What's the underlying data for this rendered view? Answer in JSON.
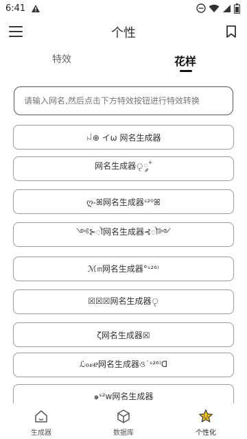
{
  "status_bar": {
    "time": "6:41",
    "icons": [
      "warning-icon",
      "do-not-disturb-icon",
      "wifi-icon",
      "signal-icon",
      "battery-icon"
    ]
  },
  "app_bar": {
    "title": "个性",
    "menu_icon": "hamburger-menu-icon",
    "bookmark_icon": "bookmark-icon"
  },
  "tabs": [
    {
      "label": "特效",
      "selected": false
    },
    {
      "label": "花样",
      "selected": true
    }
  ],
  "input": {
    "placeholder": "请输入网名,然后点击下方特效按钮进行特效转换",
    "value": ""
  },
  "results": [
    "ꈤ⊕ イω 网名生成器",
    "网名生成器ৃ༘˚",
    "ღ֊ꕤ网名生成器ˢ²⁰ꕤ",
    "༺⊱ꠧ网名生成器⊰ꠧ༻",
    "ℳ௱网名生成器°ˢ²⁶⁾",
    "☒☒☒网名生成器ৃ",
    "ζ网名生成器☒",
    "ℒℴ𝓋ℯ网名生成器ও˙ˢ²⁶⁾ᗡ",
    "๑ˢ²w网名生成器"
  ],
  "bottom_nav": [
    {
      "label": "生成器",
      "icon": "home-icon",
      "active": false
    },
    {
      "label": "数据库",
      "icon": "cube-icon",
      "active": false
    },
    {
      "label": "个性化",
      "icon": "star-face-icon",
      "active": true
    }
  ],
  "colors": {
    "accent_star": "#f5c518",
    "text": "#222222",
    "border": "#9a9a9a"
  }
}
